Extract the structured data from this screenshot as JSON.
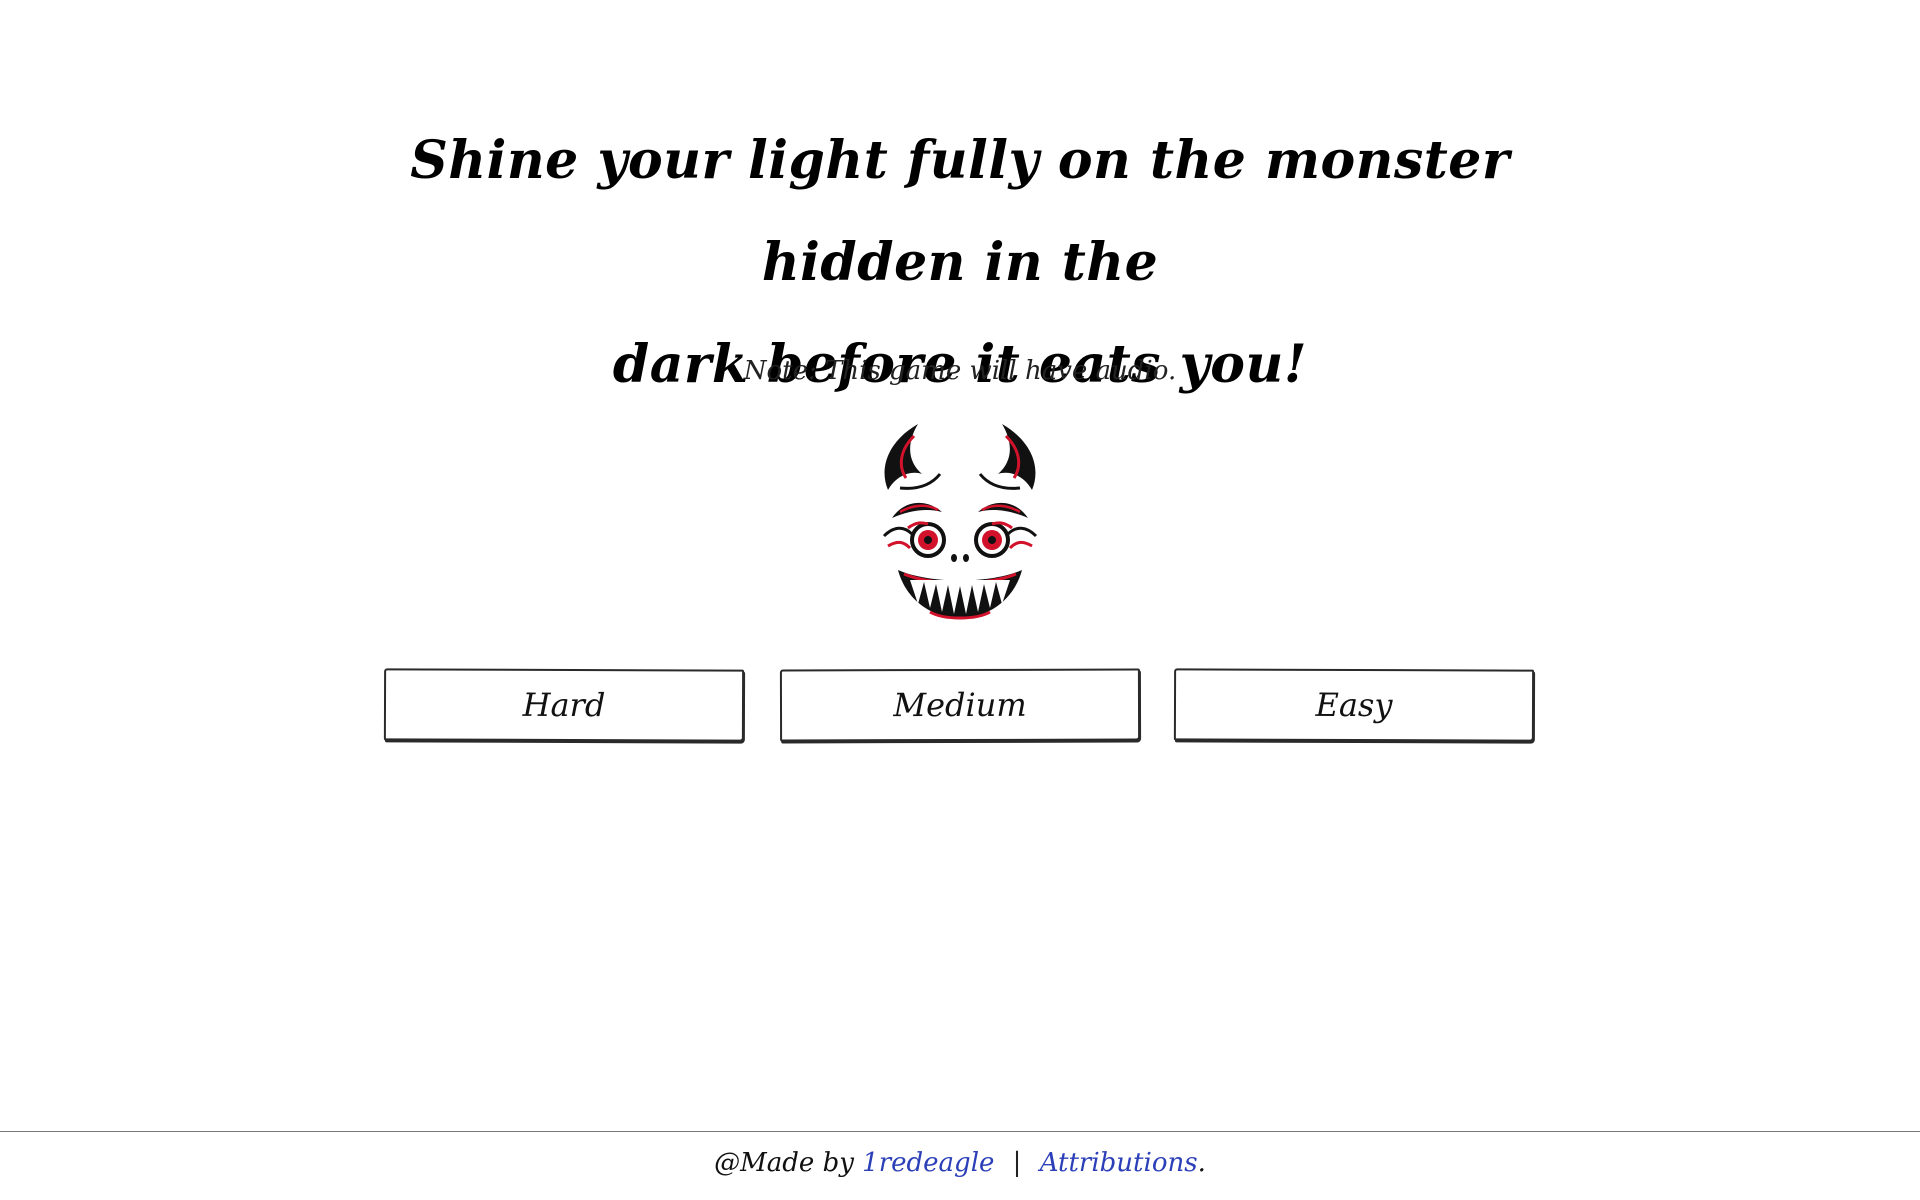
{
  "headline": {
    "line1": "Shine your light fully on the monster hidden in the",
    "line2": "dark before it eats you!"
  },
  "note": "Note: This game will have audio.",
  "monster": {
    "icon": "monster-face-icon",
    "colors": {
      "primary": "#111111",
      "accent": "#d1122a"
    }
  },
  "difficulty_buttons": [
    {
      "label": "Hard"
    },
    {
      "label": "Medium"
    },
    {
      "label": "Easy"
    }
  ],
  "footer": {
    "prefix": "@Made by",
    "author_link": "1redeagle",
    "separator": "|",
    "attributions_link": "Attributions",
    "suffix": ".",
    "link_color": "#2b3fb8"
  }
}
